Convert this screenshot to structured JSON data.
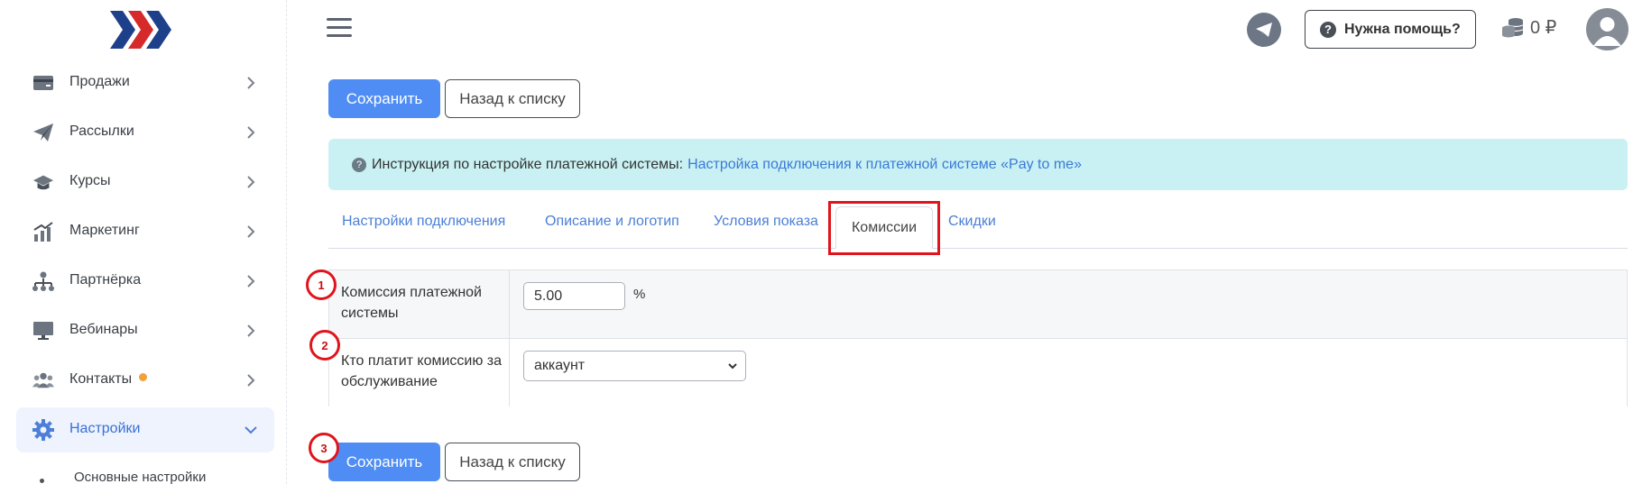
{
  "sidebar": {
    "items": [
      {
        "label": "Продажи",
        "icon": "card-icon"
      },
      {
        "label": "Рассылки",
        "icon": "paper-plane-icon"
      },
      {
        "label": "Курсы",
        "icon": "graduation-cap-icon"
      },
      {
        "label": "Маркетинг",
        "icon": "chart-icon"
      },
      {
        "label": "Партнёрка",
        "icon": "network-icon"
      },
      {
        "label": "Вебинары",
        "icon": "monitor-icon"
      },
      {
        "label": "Контакты",
        "icon": "users-icon"
      },
      {
        "label": "Настройки",
        "icon": "gear-icon"
      }
    ],
    "sub_item": "Основные настройки"
  },
  "header": {
    "help_label": "Нужна помощь?",
    "balance": "0 ₽"
  },
  "toolbar": {
    "save_label": "Сохранить",
    "back_label": "Назад к списку"
  },
  "info": {
    "text": "Инструкция по настройке платежной системы:",
    "link": "Настройка подключения к платежной системе «Pay to me»"
  },
  "tabs": [
    {
      "label": "Настройки подключения"
    },
    {
      "label": "Описание и логотип"
    },
    {
      "label": "Условия показа"
    },
    {
      "label": "Комиссии"
    },
    {
      "label": "Скидки"
    }
  ],
  "form": {
    "commission_label": "Комиссия платежной системы",
    "commission_value": "5.00",
    "commission_unit": "%",
    "payer_label": "Кто платит комиссию за обслуживание",
    "payer_value": "аккаунт"
  },
  "markers": [
    "1",
    "2",
    "3"
  ],
  "colors": {
    "primary": "#4f8df5",
    "info_bg": "#c9f1f3",
    "highlight": "#e0141c",
    "link": "#3a79d8"
  }
}
